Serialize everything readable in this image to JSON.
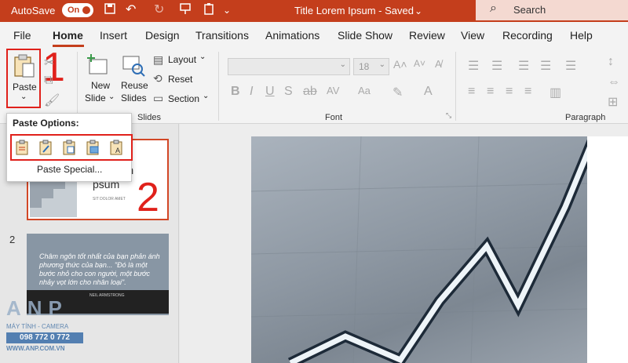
{
  "titlebar": {
    "autosave_label": "AutoSave",
    "autosave_state": "On",
    "title": "Title Lorem Ipsum  -  Saved",
    "title_chevron": "⌄",
    "search_placeholder": "Search",
    "icons": [
      "save-icon",
      "undo-icon",
      "redo-icon",
      "present-icon",
      "clipboard-icon"
    ]
  },
  "menu": {
    "items": [
      "File",
      "Home",
      "Insert",
      "Design",
      "Transitions",
      "Animations",
      "Slide Show",
      "Review",
      "View",
      "Recording",
      "Help"
    ],
    "active": "Home"
  },
  "ribbon": {
    "paste_label": "Paste",
    "new_slide": [
      "New",
      "Slide"
    ],
    "reuse_slides": [
      "Reuse",
      "Slides"
    ],
    "layout_label": "Layout",
    "reset_label": "Reset",
    "section_label": "Section",
    "slides_group": "Slides",
    "font_group": "Font",
    "paragraph_group": "Paragraph",
    "font_size": "18"
  },
  "paste_popup": {
    "title": "Paste Options:",
    "options": [
      "use-destination-theme",
      "keep-source-formatting",
      "embed",
      "picture",
      "keep-text-only"
    ],
    "special": "Paste Special..."
  },
  "annotations": {
    "step1": "1",
    "step2": "2"
  },
  "slides": {
    "slide1": {
      "title_fragment": "rem",
      "title_fragment2": "psum",
      "sub": "SIT DOLOR AMET"
    },
    "slide2": {
      "number": "2",
      "text": "Châm ngôn tốt nhất của bạn phản ánh phương thức của bạn... \"Đó là một bước nhỏ cho con người, một bước nhảy vọt lớn cho nhân loại\".",
      "author": "NEIL ARMSTRONG"
    }
  },
  "watermark": {
    "letters": "ANP",
    "sub": "MÁY TÍNH - CAMERA",
    "phone": "098 772 0 772",
    "web": "WWW.ANP.COM.VN"
  },
  "colors": {
    "accent": "#c43e1c",
    "highlight": "#e0211b"
  }
}
